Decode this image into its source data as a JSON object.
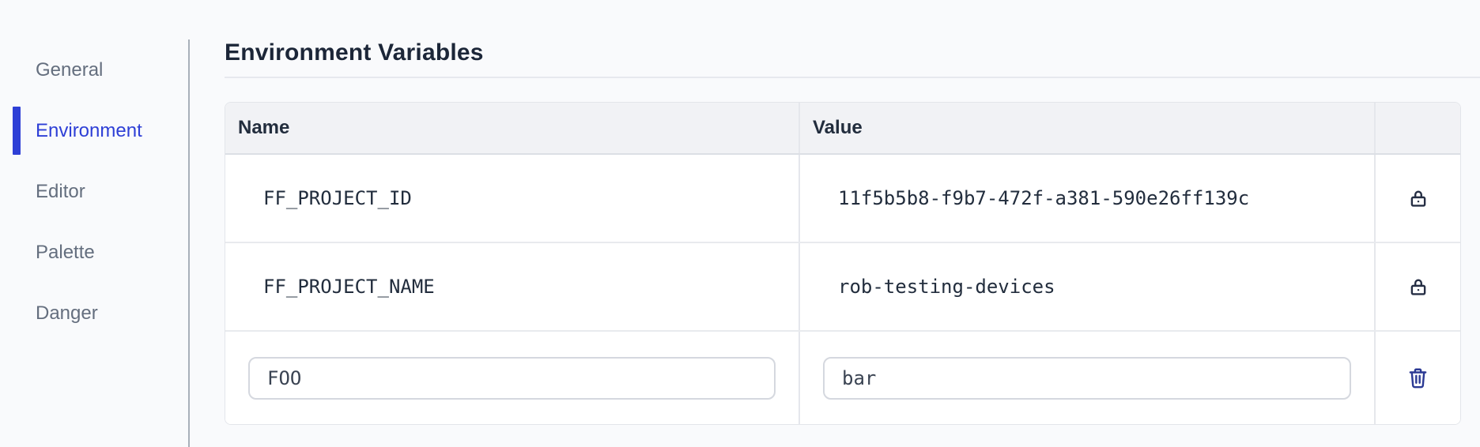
{
  "sidebar": {
    "items": [
      {
        "label": "General",
        "active": false
      },
      {
        "label": "Environment",
        "active": true
      },
      {
        "label": "Editor",
        "active": false
      },
      {
        "label": "Palette",
        "active": false
      },
      {
        "label": "Danger",
        "active": false
      }
    ]
  },
  "main": {
    "title": "Environment Variables",
    "table": {
      "name_header": "Name",
      "value_header": "Value",
      "rows": [
        {
          "name": "FF_PROJECT_ID",
          "value": "11f5b5b8-f9b7-472f-a381-590e26ff139c",
          "icon": "lock-icon"
        },
        {
          "name": "FF_PROJECT_NAME",
          "value": "rob-testing-devices",
          "icon": "lock-icon"
        }
      ],
      "new_row": {
        "name": "FOO",
        "value": "bar",
        "icon": "trash-icon"
      }
    }
  },
  "colors": {
    "accent": "#2e3fd6",
    "lock_icon": "#252e44",
    "trash_icon": "#2c3a94",
    "header_bg": "#f1f2f5",
    "page_bg": "#f9fafc"
  }
}
